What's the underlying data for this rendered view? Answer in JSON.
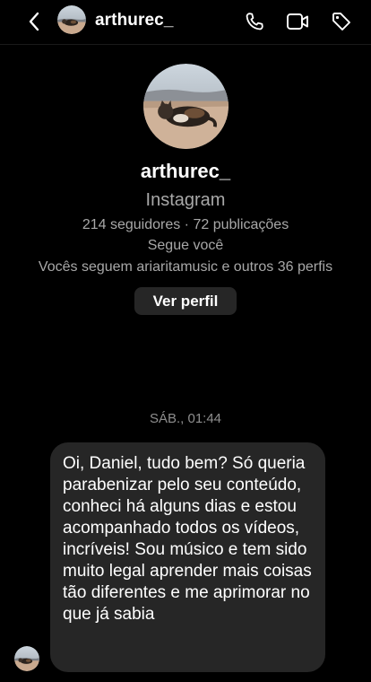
{
  "header": {
    "username": "arthurec_",
    "icons": {
      "back": "chevron-left-icon",
      "call": "phone-icon",
      "video": "video-camera-icon",
      "tag": "tag-icon"
    }
  },
  "profile": {
    "name": "arthurec_",
    "platform": "Instagram",
    "stats": "214 seguidores · 72 publicações",
    "follows_you": "Segue você",
    "mutual": "Vocês seguem ariaritamusic e outros 36 perfis",
    "view_profile_label": "Ver perfil"
  },
  "conversation": {
    "timestamp": "SÁB., 01:44",
    "messages": [
      {
        "text": "Oi, Daniel, tudo bem? Só queria parabenizar pelo seu conteúdo, conheci há alguns dias e estou acompanhado todos os vídeos, incríveis! Sou músico e tem sido muito legal aprender mais coisas tão diferentes e me aprimorar no que já sabia"
      }
    ]
  },
  "colors": {
    "background": "#000000",
    "bubble": "#262626",
    "secondary_text": "#a8a8a8"
  }
}
